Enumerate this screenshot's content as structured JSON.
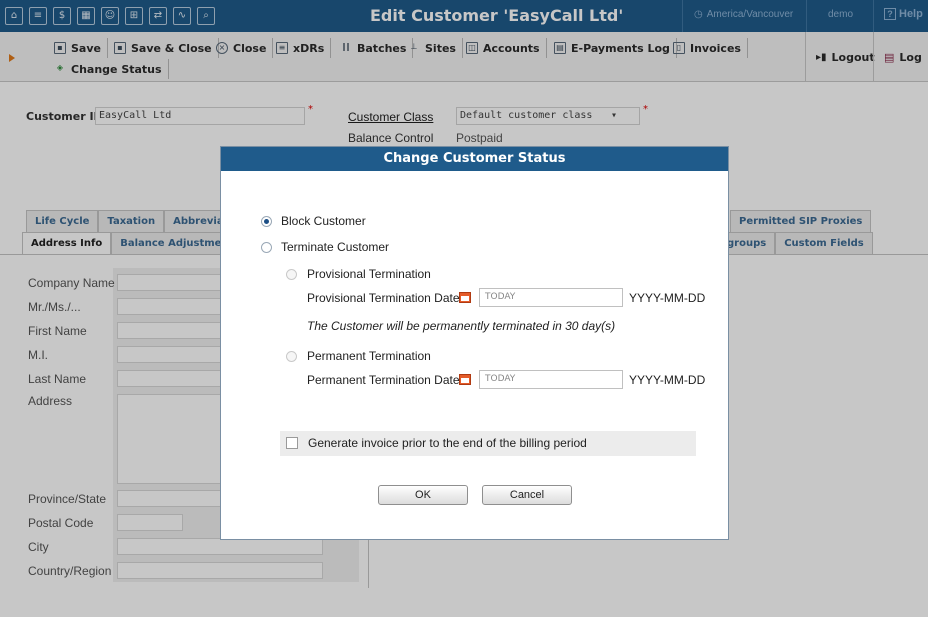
{
  "titlebar": {
    "title": "Edit Customer 'EasyCall Ltd'",
    "timezone": "America/Vancouver",
    "user": "demo",
    "help": "Help",
    "icons": [
      "home-icon",
      "list-icon",
      "dollar-icon",
      "grid-icon",
      "user-icon",
      "network-icon",
      "routing-icon",
      "chart-icon",
      "search-icon"
    ]
  },
  "toolbar": {
    "save": "Save",
    "save_close": "Save & Close",
    "close": "Close",
    "xdrs": "xDRs",
    "batches": "Batches",
    "sites": "Sites",
    "accounts": "Accounts",
    "epayments": "E-Payments Log",
    "invoices": "Invoices",
    "change_status": "Change Status",
    "logout": "Logout",
    "log": "Log"
  },
  "form": {
    "customer_id_label": "Customer ID",
    "customer_id_value": "EasyCall Ltd",
    "customer_class_label": "Customer Class",
    "customer_class_value": "Default customer class",
    "balance_control_label": "Balance Control",
    "balance_control_value": "Postpaid"
  },
  "tabs_row1": [
    "Life Cycle",
    "Taxation",
    "Abbreviated",
    "Permitted SIP Proxies"
  ],
  "tabs_row2": [
    "Address Info",
    "Balance Adjustments",
    "groups",
    "Custom Fields"
  ],
  "address": {
    "company_name": "Company Name",
    "mr_ms": "Mr./Ms./...",
    "first_name": "First Name",
    "mi": "M.I.",
    "last_name": "Last Name",
    "address": "Address",
    "province": "Province/State",
    "postal_code": "Postal Code",
    "city": "City",
    "country": "Country/Region"
  },
  "dialog": {
    "title": "Change Customer Status",
    "block": "Block Customer",
    "terminate": "Terminate Customer",
    "provisional": "Provisional Termination",
    "provisional_date_label": "Provisional Termination Date",
    "provisional_date_value": "TODAY",
    "date_format": "YYYY-MM-DD",
    "note": "The Customer will be permanently terminated in 30 day(s)",
    "permanent": "Permanent Termination",
    "permanent_date_label": "Permanent Termination Date",
    "permanent_date_value": "TODAY",
    "date_format2": "YYYY-MM-DD",
    "invoice": "Generate invoice prior to the end of the billing period",
    "ok": "OK",
    "cancel": "Cancel"
  }
}
